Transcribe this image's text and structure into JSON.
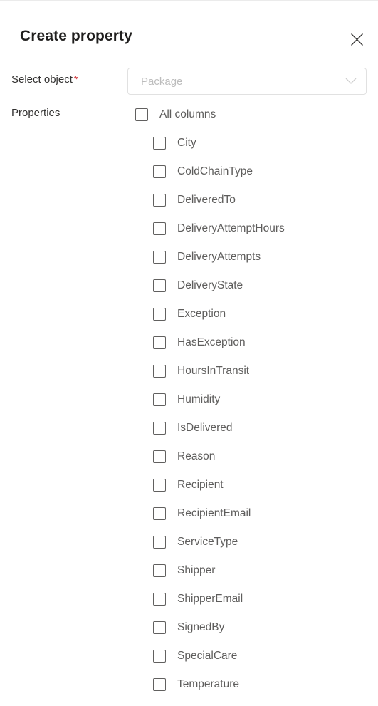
{
  "header": {
    "title": "Create property",
    "close_icon": "close-icon"
  },
  "select_object": {
    "label": "Select object",
    "required_marker": "*",
    "placeholder": "Package",
    "value": "",
    "chevron_icon": "chevron-down-icon"
  },
  "properties": {
    "label": "Properties",
    "select_all": {
      "label": "All columns",
      "checked": false
    },
    "items": [
      {
        "label": "City",
        "checked": false
      },
      {
        "label": "ColdChainType",
        "checked": false
      },
      {
        "label": "DeliveredTo",
        "checked": false
      },
      {
        "label": "DeliveryAttemptHours",
        "checked": false
      },
      {
        "label": "DeliveryAttempts",
        "checked": false
      },
      {
        "label": "DeliveryState",
        "checked": false
      },
      {
        "label": "Exception",
        "checked": false
      },
      {
        "label": "HasException",
        "checked": false
      },
      {
        "label": "HoursInTransit",
        "checked": false
      },
      {
        "label": "Humidity",
        "checked": false
      },
      {
        "label": "IsDelivered",
        "checked": false
      },
      {
        "label": "Reason",
        "checked": false
      },
      {
        "label": "Recipient",
        "checked": false
      },
      {
        "label": "RecipientEmail",
        "checked": false
      },
      {
        "label": "ServiceType",
        "checked": false
      },
      {
        "label": "Shipper",
        "checked": false
      },
      {
        "label": "ShipperEmail",
        "checked": false
      },
      {
        "label": "SignedBy",
        "checked": false
      },
      {
        "label": "SpecialCare",
        "checked": false
      },
      {
        "label": "Temperature",
        "checked": false
      }
    ]
  },
  "colors": {
    "title": "#201f1e",
    "label": "#323130",
    "item_text": "#5e5d5c",
    "required": "#d13438",
    "placeholder": "#bdbdbd",
    "border": "#e1e1e1",
    "checkbox_border": "#61605f"
  }
}
